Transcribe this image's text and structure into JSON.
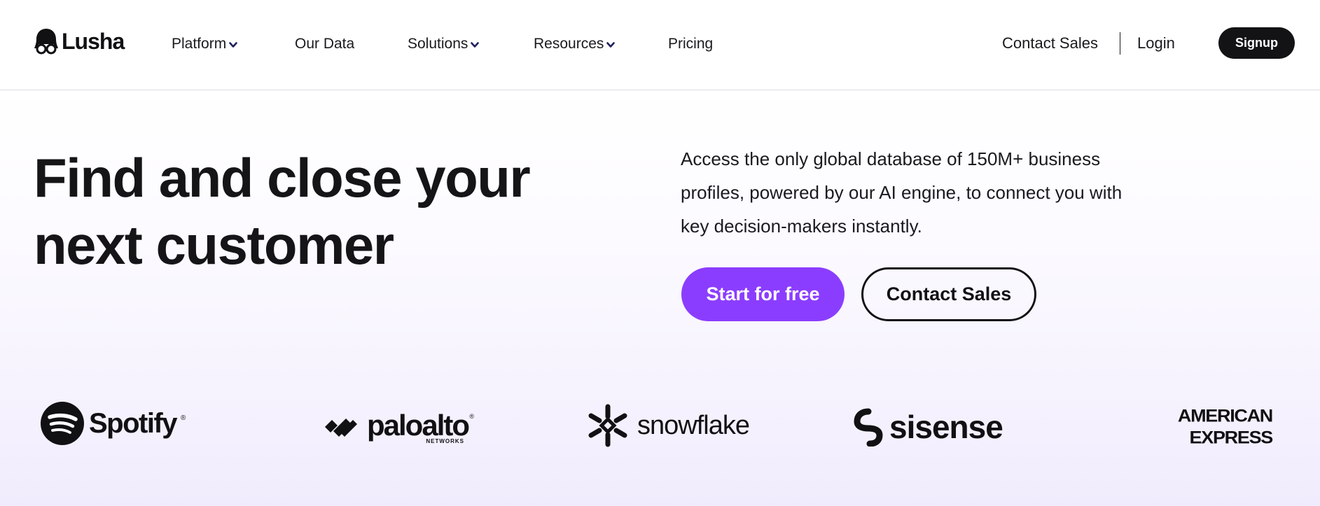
{
  "header": {
    "logo_text": "Lusha",
    "nav": [
      {
        "label": "Platform",
        "has_dropdown": true
      },
      {
        "label": "Our Data",
        "has_dropdown": false
      },
      {
        "label": "Solutions",
        "has_dropdown": true
      },
      {
        "label": "Resources",
        "has_dropdown": true
      },
      {
        "label": "Pricing",
        "has_dropdown": false
      }
    ],
    "contact_sales": "Contact Sales",
    "login": "Login",
    "signup": "Signup"
  },
  "hero": {
    "title_lines": [
      "Find and close your",
      "next customer"
    ],
    "description_lines": [
      "Access the only global database of 150M+ business",
      "profiles, powered by our AI engine, to connect you with",
      "key decision-makers instantly."
    ],
    "primary_cta": "Start for free",
    "secondary_cta": "Contact Sales"
  },
  "brands": {
    "spotify": {
      "name": "Spotify",
      "reg": "®"
    },
    "paloalto": {
      "name": "paloalto",
      "sub": "NETWORKS",
      "reg": "®"
    },
    "snowflake": {
      "name": "snowflake"
    },
    "sisense": {
      "name": "sisense"
    },
    "amex": {
      "lines": [
        "AMERICAN",
        "EXPRESS"
      ]
    }
  },
  "colors": {
    "primary": "#8b3dff",
    "dark": "#131316",
    "text": "#1a1a1f"
  },
  "icons": [
    "lusha-logo-icon",
    "chevron-down-icon",
    "spotify-logo-icon",
    "paloalto-logo-icon",
    "snowflake-logo-icon",
    "sisense-logo-icon"
  ]
}
